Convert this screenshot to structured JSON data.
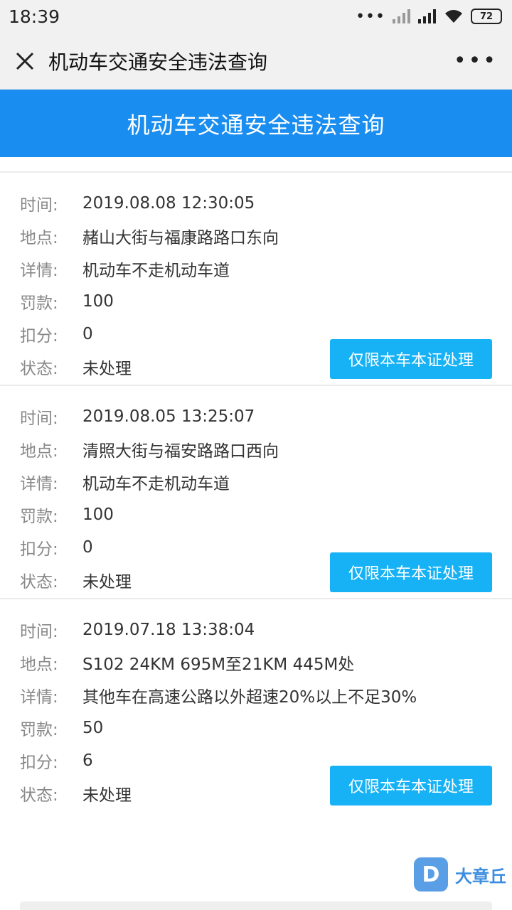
{
  "status": {
    "time": "18:39",
    "battery": "72"
  },
  "nav": {
    "title": "机动车交通安全违法查询"
  },
  "header": {
    "title": "机动车交通安全违法查询"
  },
  "labels": {
    "time": "时间:",
    "location": "地点:",
    "detail": "详情:",
    "fine": "罚款:",
    "points": "扣分:",
    "status": "状态:"
  },
  "records": [
    {
      "time": "2019.08.08 12:30:05",
      "location": "赭山大街与福康路路口东向",
      "detail": "机动车不走机动车道",
      "fine": "100",
      "points": "0",
      "status": "未处理",
      "button": "仅限本车本证处理"
    },
    {
      "time": "2019.08.05 13:25:07",
      "location": "清照大街与福安路路口西向",
      "detail": "机动车不走机动车道",
      "fine": "100",
      "points": "0",
      "status": "未处理",
      "button": "仅限本车本证处理"
    },
    {
      "time": "2019.07.18 13:38:04",
      "location": "S102 24KM 695M至21KM 445M处",
      "detail": "其他车在高速公路以外超速20%以上不足30%",
      "fine": "50",
      "points": "6",
      "status": "未处理",
      "button": "仅限本车本证处理"
    }
  ],
  "watermark": {
    "logo": "D",
    "text": "大章丘"
  }
}
